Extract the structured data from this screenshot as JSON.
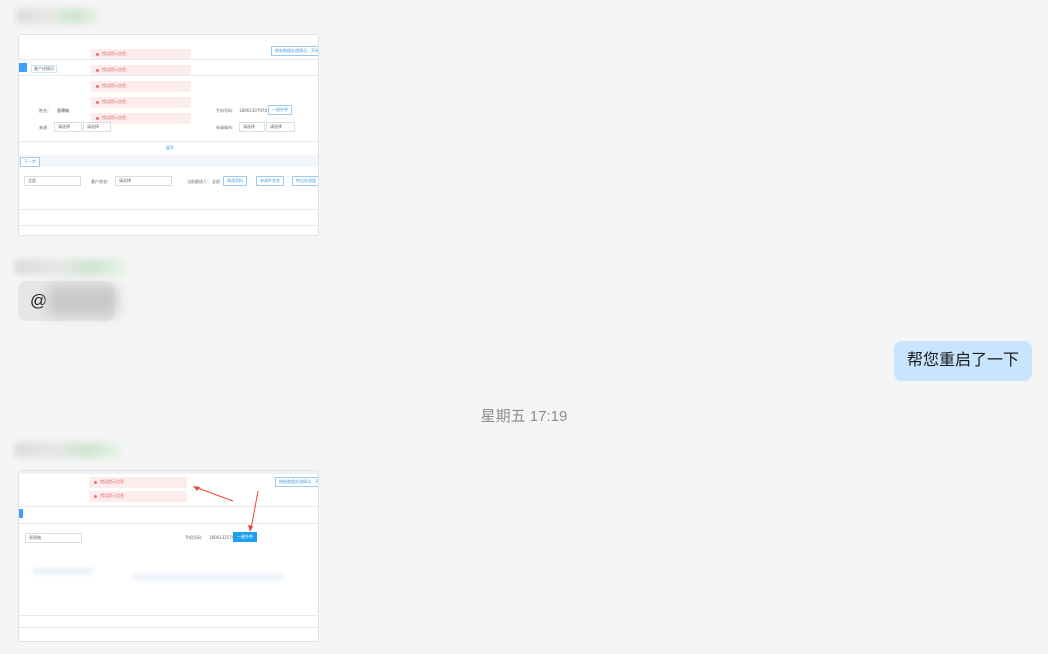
{
  "chat": {
    "mention_prefix": "@",
    "reply_text": "帮您重启了一下",
    "timestamp": "星期五 17:19"
  },
  "shot1": {
    "error_items": [
      "错误提示信息",
      "错误提示信息",
      "错误提示信息",
      "错误提示信息",
      "错误提示信息"
    ],
    "top_right_button": "刷新数据处理情况，开始",
    "tab_label": "客户详情页",
    "name_label": "姓名：",
    "name_value": "晋锦城",
    "phone_label": "手机号码：",
    "phone_value": "18061307970",
    "call_button": "一键外呼",
    "source_label": "来源：",
    "select_placeholder": "请选择",
    "city_label": "申请城市：",
    "expand_text": "展开",
    "next_button": "下一步",
    "filter_all": "全部",
    "customer_status_label": "客户状态：",
    "current_label": "当前跟进人：",
    "current_value": "全部",
    "btn_a": "修改资料",
    "btn_b": "申请件状态",
    "btn_c": "转出处理量"
  },
  "shot2": {
    "error_items": [
      "错误提示信息",
      "错误提示信息"
    ],
    "top_right_button": "刷新数据处理情况，开始",
    "input_value": "晋锦城",
    "phone_label": "手机号码：",
    "phone_value": "18061325799",
    "call_button": "一键外呼"
  },
  "colors": {
    "accent": "#409eff",
    "bubble_self": "#c9e4ff",
    "error_pink": "#fdecec",
    "annotation_red": "#e8473c"
  }
}
